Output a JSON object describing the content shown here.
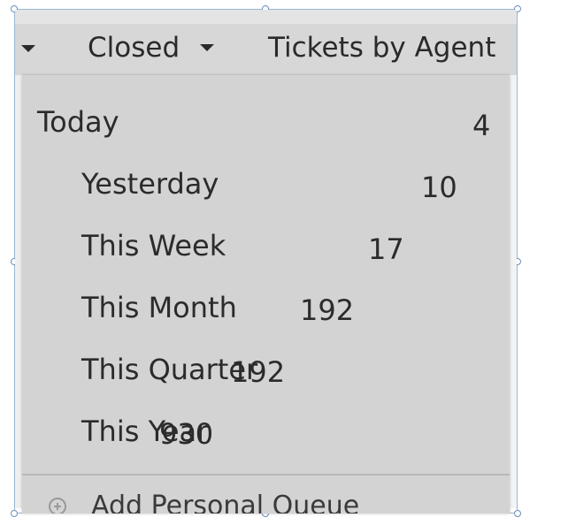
{
  "menubar": {
    "closed_label": "Closed",
    "tickets_by_agent_label": "Tickets by Agent"
  },
  "dropdown": {
    "items": [
      {
        "label": "Today",
        "count": "4"
      },
      {
        "label": "Yesterday",
        "count": "10"
      },
      {
        "label": "This Week",
        "count": "17"
      },
      {
        "label": "This Month",
        "count": "192"
      },
      {
        "label": "This Quarter",
        "count": "192"
      },
      {
        "label": "This Year",
        "count": "930"
      }
    ],
    "add_personal_queue_label": "Add Personal Queue"
  }
}
